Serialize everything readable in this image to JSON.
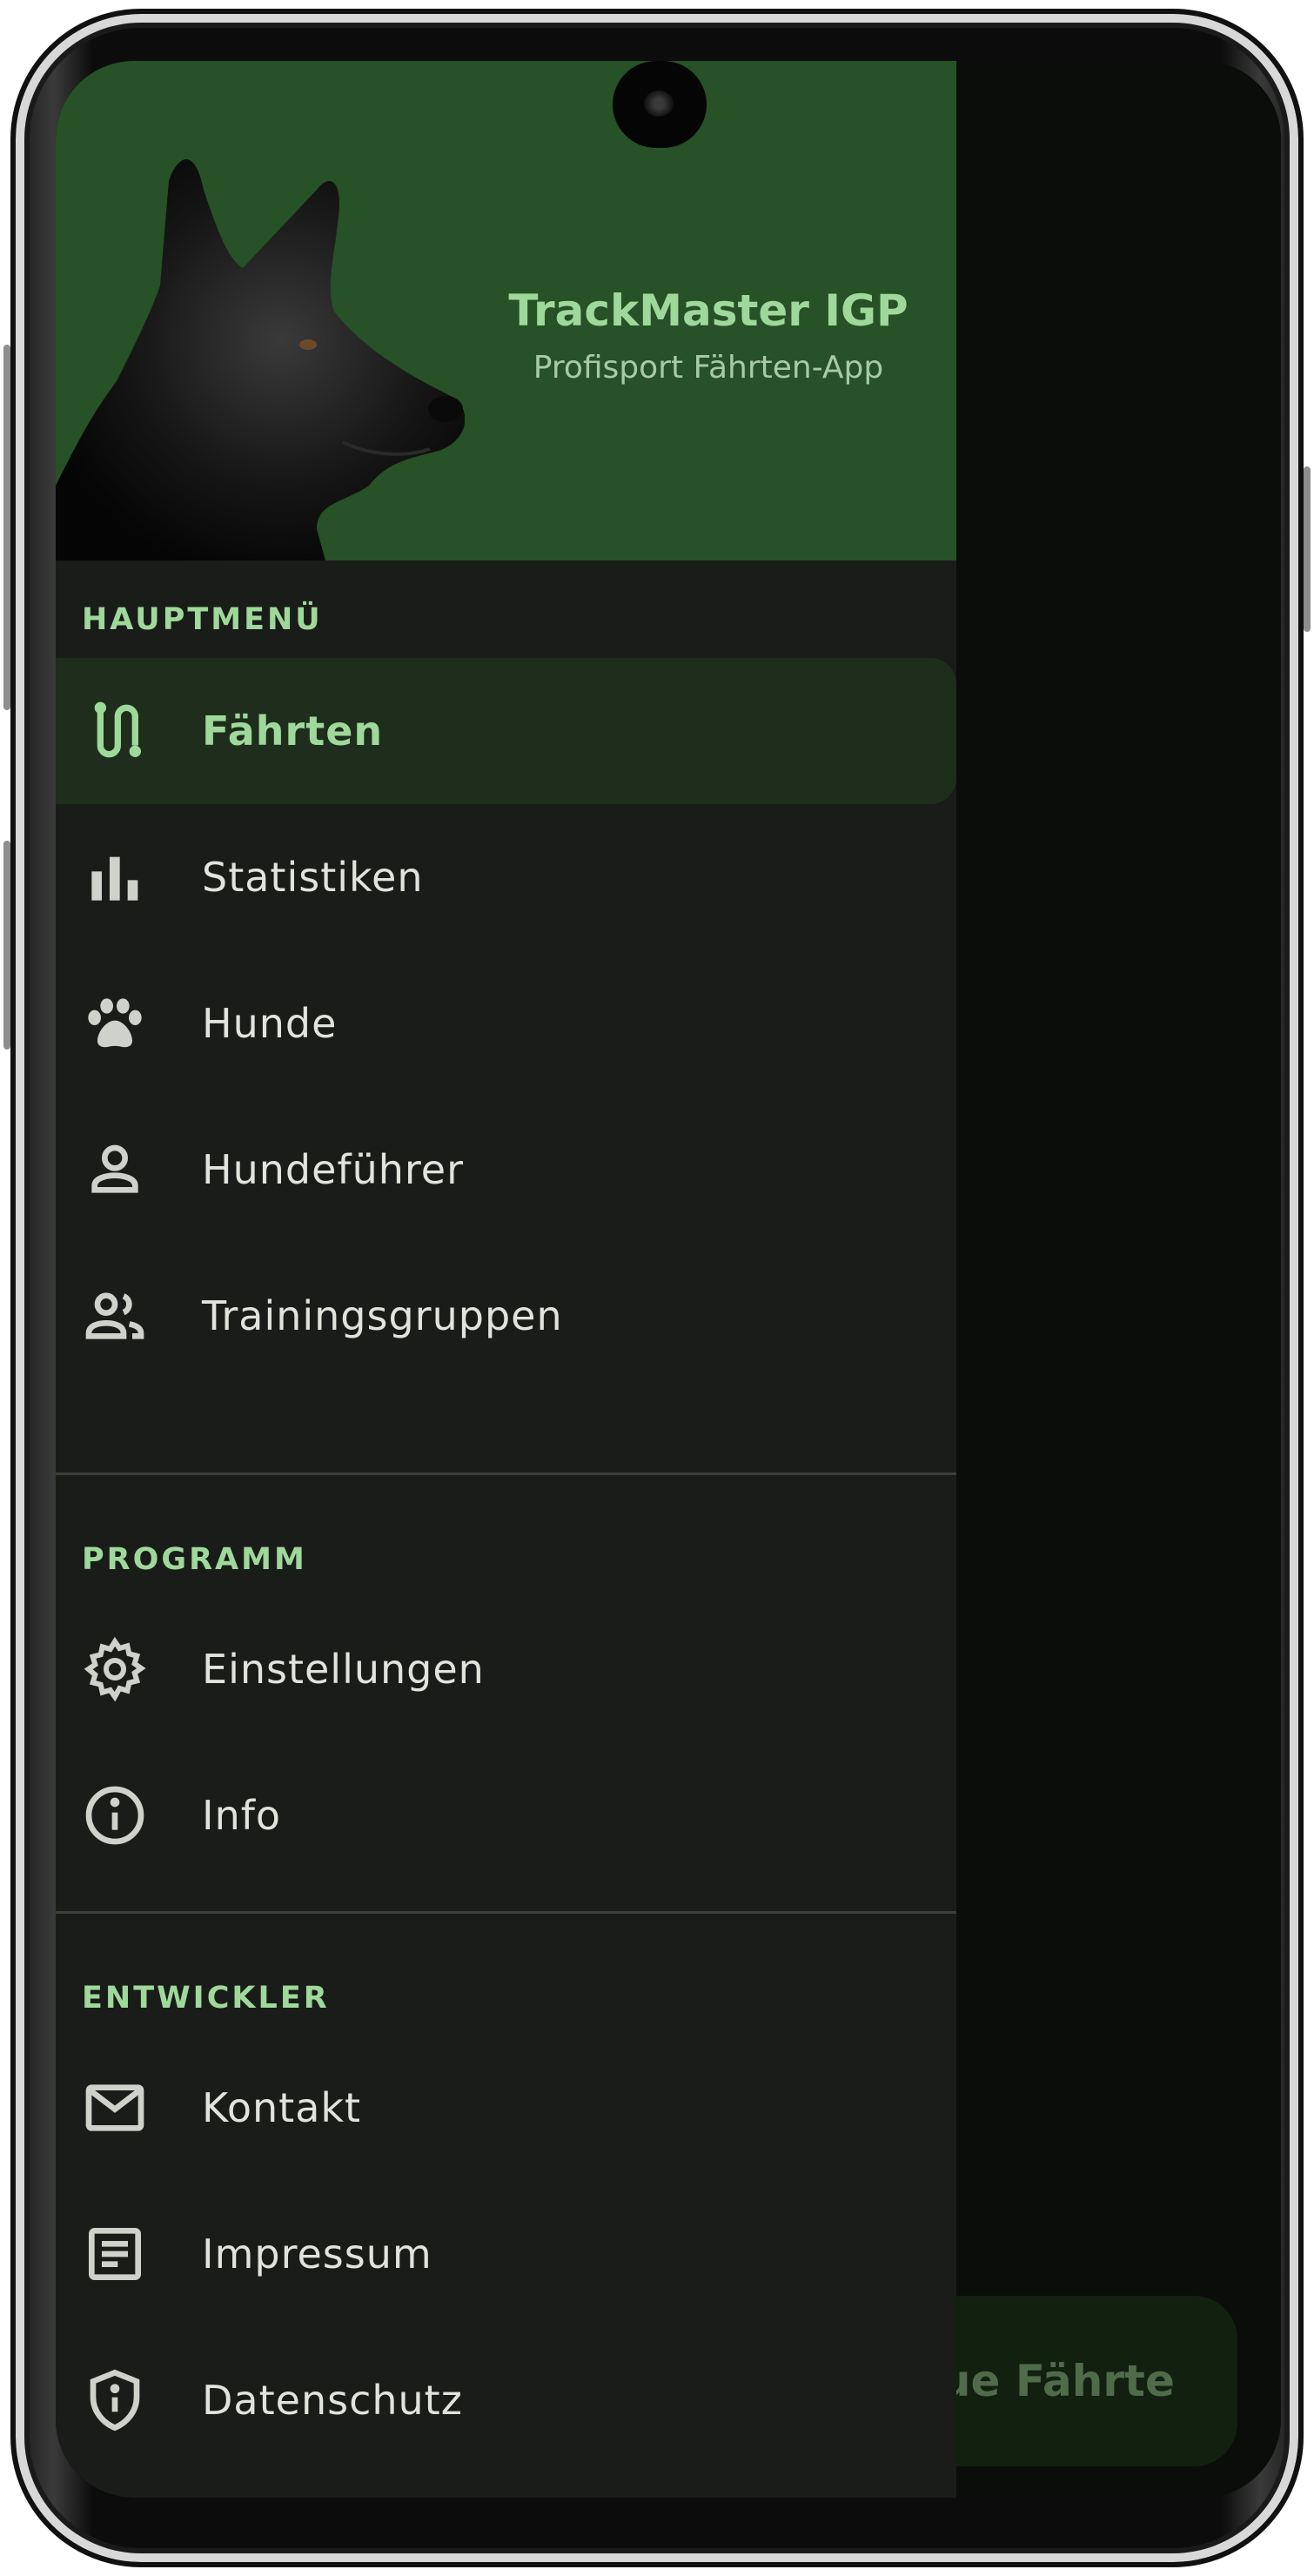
{
  "header": {
    "title": "TrackMaster IGP",
    "subtitle": "Profisport Fährten-App"
  },
  "sections": {
    "main": {
      "title": "HAUPTMENÜ",
      "items": [
        {
          "label": "Fährten",
          "icon": "route-icon",
          "active": true
        },
        {
          "label": "Statistiken",
          "icon": "bar-chart-icon"
        },
        {
          "label": "Hunde",
          "icon": "paw-icon"
        },
        {
          "label": "Hundeführer",
          "icon": "person-icon"
        },
        {
          "label": "Trainingsgruppen",
          "icon": "group-icon"
        }
      ]
    },
    "program": {
      "title": "PROGRAMM",
      "items": [
        {
          "label": "Einstellungen",
          "icon": "gear-icon"
        },
        {
          "label": "Info",
          "icon": "info-icon"
        }
      ]
    },
    "developer": {
      "title": "ENTWICKLER",
      "items": [
        {
          "label": "Kontakt",
          "icon": "mail-icon"
        },
        {
          "label": "Impressum",
          "icon": "document-icon"
        },
        {
          "label": "Datenschutz",
          "icon": "shield-icon"
        }
      ]
    }
  },
  "fab": {
    "label": "eue Fährte"
  },
  "colors": {
    "accent": "#9fd89b",
    "header_bg": "#275126",
    "drawer_bg": "#1a1c19",
    "active_bg": "#1e2d1c",
    "text": "#e2e3dd"
  }
}
